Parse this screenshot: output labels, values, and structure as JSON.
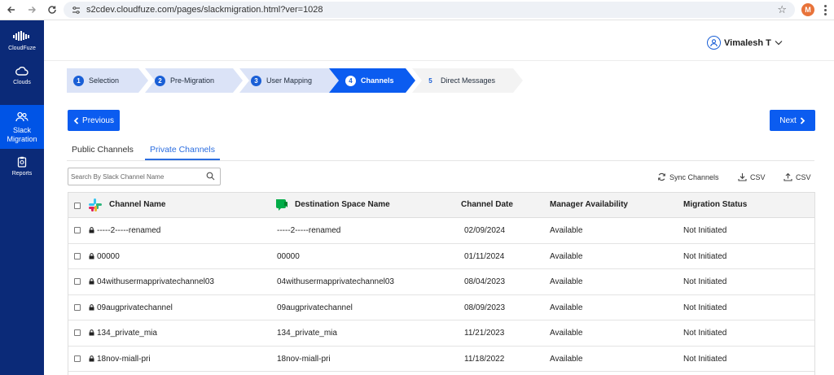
{
  "browser": {
    "url": "s2cdev.cloudfuze.com/pages/slackmigration.html?ver=1028",
    "profile_initial": "M"
  },
  "sidebar": {
    "brand": "CloudFuze",
    "items": [
      {
        "label": "Clouds",
        "icon": "cloud-icon"
      },
      {
        "label": "Slack Migration",
        "icon": "users-icon",
        "active": true
      },
      {
        "label": "Reports",
        "icon": "clipboard-icon"
      }
    ]
  },
  "header": {
    "user_name": "Vimalesh T"
  },
  "stepper": {
    "steps": [
      {
        "num": "1",
        "label": "Selection",
        "state": "done"
      },
      {
        "num": "2",
        "label": "Pre-Migration",
        "state": "done"
      },
      {
        "num": "3",
        "label": "User Mapping",
        "state": "done"
      },
      {
        "num": "4",
        "label": "Channels",
        "state": "active"
      },
      {
        "num": "5",
        "label": "Direct Messages",
        "state": "future"
      }
    ]
  },
  "nav": {
    "previous": "Previous",
    "next": "Next"
  },
  "tabs": {
    "public": "Public Channels",
    "private": "Private Channels"
  },
  "search": {
    "placeholder": "Search By Slack Channel Name"
  },
  "actions": {
    "sync": "Sync Channels",
    "download_csv": "CSV",
    "upload_csv": "CSV"
  },
  "table": {
    "headers": {
      "channel_name": "Channel Name",
      "destination": "Destination Space Name",
      "date": "Channel Date",
      "manager": "Manager Availability",
      "status": "Migration Status"
    },
    "rows": [
      {
        "channel": "-----2-----renamed",
        "destination": "-----2-----renamed",
        "date": "02/09/2024",
        "manager": "Available",
        "status": "Not Initiated"
      },
      {
        "channel": "00000",
        "destination": "00000",
        "date": "01/11/2024",
        "manager": "Available",
        "status": "Not Initiated"
      },
      {
        "channel": "04withusermapprivatechannel03",
        "destination": "04withusermapprivatechannel03",
        "date": "08/04/2023",
        "manager": "Available",
        "status": "Not Initiated"
      },
      {
        "channel": "09augprivatechannel",
        "destination": "09augprivatechannel",
        "date": "08/09/2023",
        "manager": "Available",
        "status": "Not Initiated"
      },
      {
        "channel": "134_private_mia",
        "destination": "134_private_mia",
        "date": "11/21/2023",
        "manager": "Available",
        "status": "Not Initiated"
      },
      {
        "channel": "18nov-miall-pri",
        "destination": "18nov-miall-pri",
        "date": "11/18/2022",
        "manager": "Available",
        "status": "Not Initiated"
      }
    ]
  },
  "colors": {
    "sidebar": "#0b2a78",
    "accent": "#0b5cf0",
    "step_done": "#dbe3f7",
    "step_active": "#0b5cf0"
  }
}
